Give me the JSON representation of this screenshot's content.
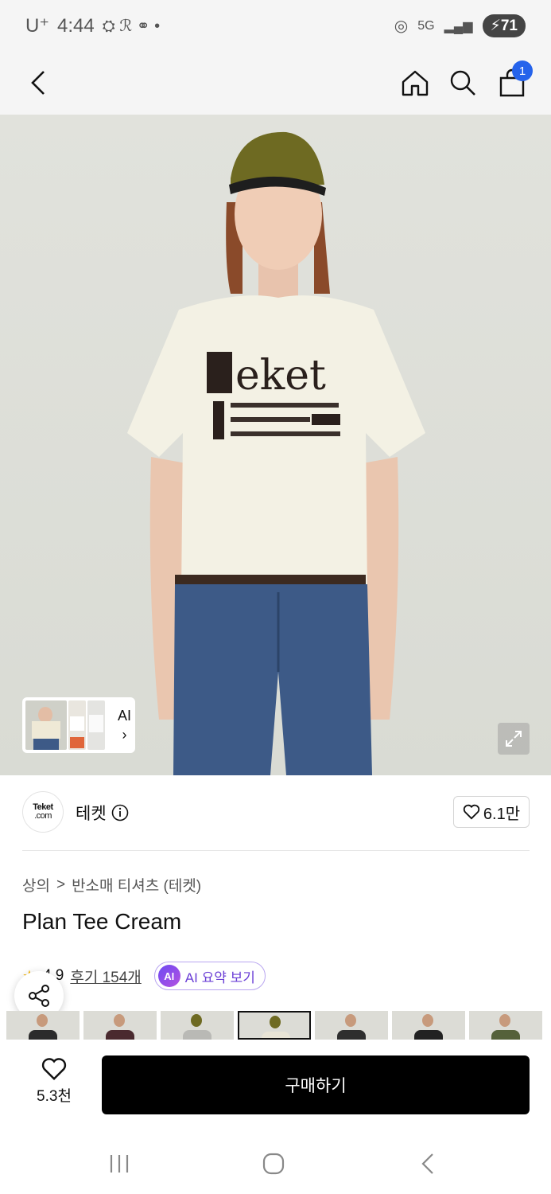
{
  "status_bar": {
    "carrier": "U⁺",
    "time": "4:44",
    "network": "5G",
    "battery": "71"
  },
  "header": {
    "cart_count": "1"
  },
  "gallery": {
    "ai_label": "AI",
    "ai_chevron": "›"
  },
  "brand": {
    "logo_text_line1": "Teket",
    "logo_text_line2": ".com",
    "name": "테켓",
    "likes": "6.1만"
  },
  "product": {
    "breadcrumb": [
      "상의",
      "반소매 티셔츠 (테켓)"
    ],
    "breadcrumb_sep": ">",
    "title": "Plan Tee Cream",
    "rating": "4.9",
    "reviews": "후기 154개",
    "ai_badge": "AI",
    "ai_summary": "AI 요약 보기"
  },
  "color_options": [
    {
      "shirt": "#2b2b2b"
    },
    {
      "shirt": "#4a2a2f"
    },
    {
      "shirt": "#b9b9b5"
    },
    {
      "shirt": "#e8e4d6"
    },
    {
      "shirt": "#2e2e2e"
    },
    {
      "shirt": "#222222"
    },
    {
      "shirt": "#55613a"
    }
  ],
  "bottom_bar": {
    "wish_count": "5.3천",
    "buy_label": "구매하기"
  },
  "colors": {
    "accent_blue": "#2563eb",
    "ai_purple": "#6b3fd6"
  }
}
